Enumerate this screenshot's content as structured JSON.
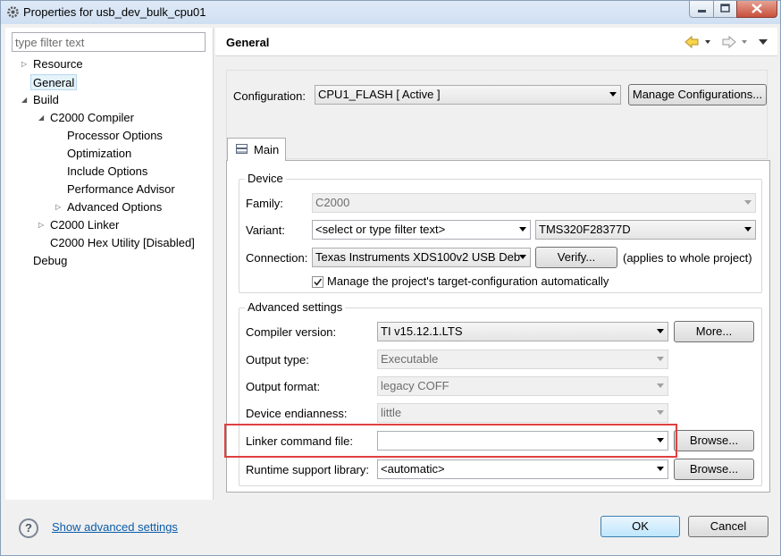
{
  "window": {
    "title": "Properties for usb_dev_bulk_cpu01"
  },
  "left": {
    "filter_placeholder": "type filter text",
    "tree": [
      {
        "label": "Resource",
        "indent": 0,
        "expander": "collapsed"
      },
      {
        "label": "General",
        "indent": 0,
        "expander": "none",
        "selected": true
      },
      {
        "label": "Build",
        "indent": 0,
        "expander": "expanded"
      },
      {
        "label": "C2000 Compiler",
        "indent": 1,
        "expander": "expanded"
      },
      {
        "label": "Processor Options",
        "indent": 2,
        "expander": "none"
      },
      {
        "label": "Optimization",
        "indent": 2,
        "expander": "none"
      },
      {
        "label": "Include Options",
        "indent": 2,
        "expander": "none"
      },
      {
        "label": "Performance Advisor",
        "indent": 2,
        "expander": "none"
      },
      {
        "label": "Advanced Options",
        "indent": 2,
        "expander": "collapsed"
      },
      {
        "label": "C2000 Linker",
        "indent": 1,
        "expander": "collapsed"
      },
      {
        "label": "C2000 Hex Utility  [Disabled]",
        "indent": 1,
        "expander": "none"
      },
      {
        "label": "Debug",
        "indent": 0,
        "expander": "none"
      }
    ]
  },
  "header": {
    "title": "General"
  },
  "config": {
    "label": "Configuration:",
    "value": "CPU1_FLASH  [ Active ]",
    "manage_button": "Manage Configurations..."
  },
  "tabs": {
    "main_label": "Main"
  },
  "device": {
    "group_title": "Device",
    "family_label": "Family:",
    "family_value": "C2000",
    "variant_label": "Variant:",
    "variant_filter": "<select or type filter text>",
    "variant_value": "TMS320F28377D",
    "connection_label": "Connection:",
    "connection_value": "Texas Instruments XDS100v2 USB Deb",
    "verify_button": "Verify...",
    "applies_note": "(applies to whole project)",
    "manage_checkbox_label": "Manage the project's target-configuration automatically",
    "manage_checkbox_checked": true
  },
  "advanced": {
    "group_title": "Advanced settings",
    "compiler_label": "Compiler version:",
    "compiler_value": "TI v15.12.1.LTS",
    "more_button": "More...",
    "output_type_label": "Output type:",
    "output_type_value": "Executable",
    "output_format_label": "Output format:",
    "output_format_value": "legacy COFF",
    "endianness_label": "Device endianness:",
    "endianness_value": "little",
    "linker_label": "Linker command file:",
    "linker_value": "",
    "browse_button": "Browse...",
    "runtime_label": "Runtime support library:",
    "runtime_value": "<automatic>"
  },
  "footer": {
    "help_symbol": "?",
    "advanced_link": "Show advanced settings",
    "ok_button": "OK",
    "cancel_button": "Cancel"
  },
  "colors": {
    "highlight": "#e04040",
    "link": "#0a5ca8"
  }
}
